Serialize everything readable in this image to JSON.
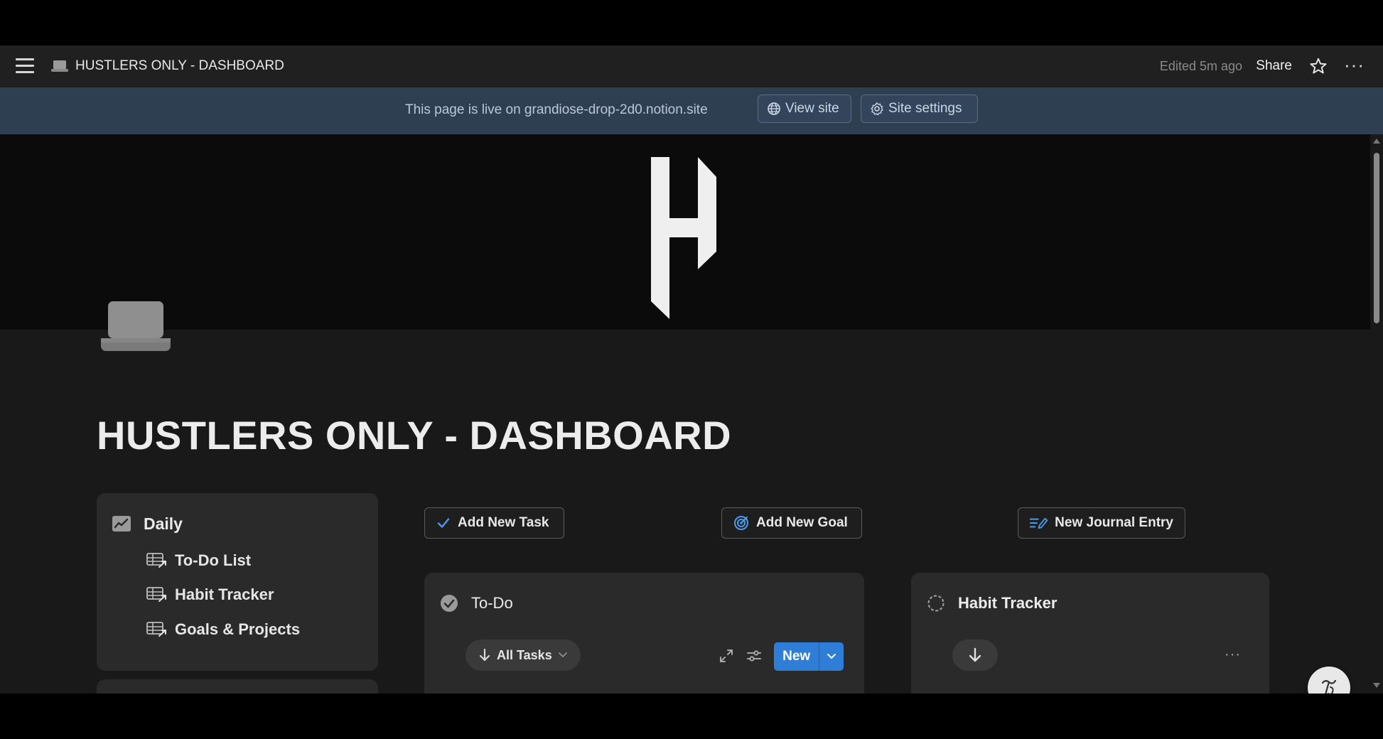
{
  "topbar": {
    "breadcrumb_title": "HUSTLERS ONLY - DASHBOARD",
    "edited": "Edited 5m ago",
    "share_label": "Share",
    "more_label": "···"
  },
  "banner": {
    "text": "This page is live on grandiose-drop-2d0.notion.site",
    "view_site_label": "View site",
    "site_settings_label": "Site settings"
  },
  "page": {
    "title": "HUSTLERS ONLY - DASHBOARD"
  },
  "sidebar": {
    "heading": "Daily",
    "links": [
      {
        "label": "To-Do List"
      },
      {
        "label": "Habit Tracker"
      },
      {
        "label": "Goals & Projects"
      }
    ]
  },
  "actions": {
    "add_task": "Add New Task",
    "add_goal": "Add New Goal",
    "new_journal": "New Journal Entry"
  },
  "todo": {
    "title": "To-Do",
    "view_label": "All Tasks",
    "new_label": "New"
  },
  "habit": {
    "title": "Habit Tracker",
    "more_label": "···"
  },
  "colors": {
    "accent": "#2e7dd6",
    "banner_bg": "#2f3f52",
    "page_bg": "#191919",
    "card_bg": "#2a2a2a"
  },
  "icons": {
    "menu": "hamburger-icon",
    "page": "laptop-icon",
    "star": "star-icon",
    "globe": "globe-icon",
    "gear": "gear-icon",
    "check": "check-icon",
    "target": "target-icon",
    "journal": "pencil-lines-icon",
    "database": "database-link-icon"
  }
}
